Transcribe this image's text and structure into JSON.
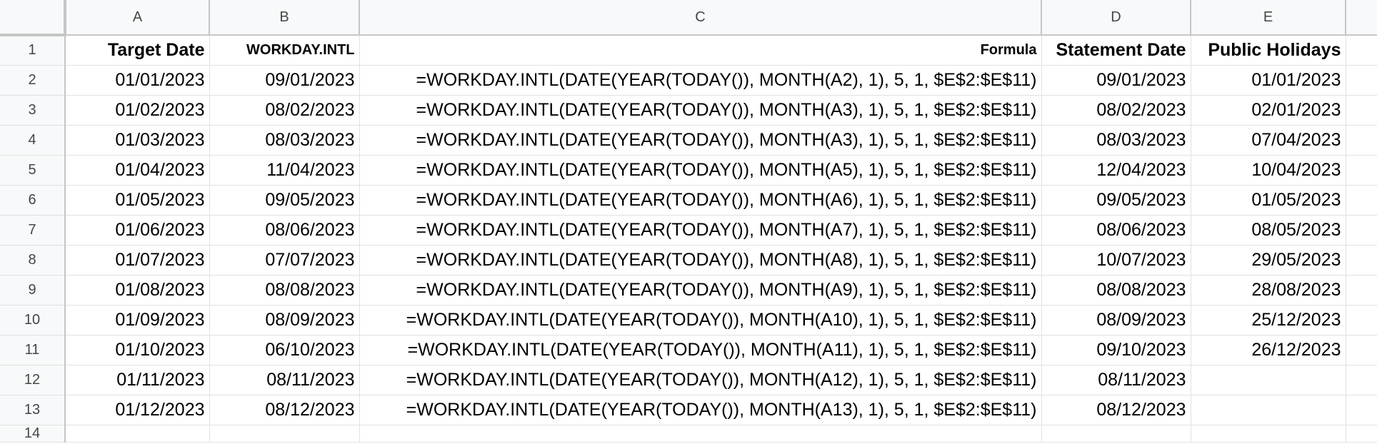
{
  "columns": [
    "A",
    "B",
    "C",
    "D",
    "E"
  ],
  "header_row": {
    "num": "1",
    "a": "Target Date",
    "b": "WORKDAY.INTL",
    "c": "Formula",
    "d": "Statement Date",
    "e": "Public Holidays"
  },
  "rows": [
    {
      "num": "2",
      "a": "01/01/2023",
      "b": "09/01/2023",
      "c": "=WORKDAY.INTL(DATE(YEAR(TODAY()), MONTH(A2), 1), 5, 1, $E$2:$E$11)",
      "d": "09/01/2023",
      "e": "01/01/2023"
    },
    {
      "num": "3",
      "a": "01/02/2023",
      "b": "08/02/2023",
      "c": "=WORKDAY.INTL(DATE(YEAR(TODAY()), MONTH(A3), 1), 5, 1, $E$2:$E$11)",
      "d": "08/02/2023",
      "e": "02/01/2023"
    },
    {
      "num": "4",
      "a": "01/03/2023",
      "b": "08/03/2023",
      "c": "=WORKDAY.INTL(DATE(YEAR(TODAY()), MONTH(A3), 1), 5, 1, $E$2:$E$11)",
      "d": "08/03/2023",
      "e": "07/04/2023"
    },
    {
      "num": "5",
      "a": "01/04/2023",
      "b": "11/04/2023",
      "c": "=WORKDAY.INTL(DATE(YEAR(TODAY()), MONTH(A5), 1), 5, 1, $E$2:$E$11)",
      "d": "12/04/2023",
      "e": "10/04/2023"
    },
    {
      "num": "6",
      "a": "01/05/2023",
      "b": "09/05/2023",
      "c": "=WORKDAY.INTL(DATE(YEAR(TODAY()), MONTH(A6), 1), 5, 1, $E$2:$E$11)",
      "d": "09/05/2023",
      "e": "01/05/2023"
    },
    {
      "num": "7",
      "a": "01/06/2023",
      "b": "08/06/2023",
      "c": "=WORKDAY.INTL(DATE(YEAR(TODAY()), MONTH(A7), 1), 5, 1, $E$2:$E$11)",
      "d": "08/06/2023",
      "e": "08/05/2023"
    },
    {
      "num": "8",
      "a": "01/07/2023",
      "b": "07/07/2023",
      "c": "=WORKDAY.INTL(DATE(YEAR(TODAY()), MONTH(A8), 1), 5, 1, $E$2:$E$11)",
      "d": "10/07/2023",
      "e": "29/05/2023"
    },
    {
      "num": "9",
      "a": "01/08/2023",
      "b": "08/08/2023",
      "c": "=WORKDAY.INTL(DATE(YEAR(TODAY()), MONTH(A9), 1), 5, 1, $E$2:$E$11)",
      "d": "08/08/2023",
      "e": "28/08/2023"
    },
    {
      "num": "10",
      "a": "01/09/2023",
      "b": "08/09/2023",
      "c": "=WORKDAY.INTL(DATE(YEAR(TODAY()), MONTH(A10), 1), 5, 1, $E$2:$E$11)",
      "d": "08/09/2023",
      "e": "25/12/2023"
    },
    {
      "num": "11",
      "a": "01/10/2023",
      "b": "06/10/2023",
      "c": "=WORKDAY.INTL(DATE(YEAR(TODAY()), MONTH(A11), 1), 5, 1, $E$2:$E$11)",
      "d": "09/10/2023",
      "e": "26/12/2023"
    },
    {
      "num": "12",
      "a": "01/11/2023",
      "b": "08/11/2023",
      "c": "=WORKDAY.INTL(DATE(YEAR(TODAY()), MONTH(A12), 1), 5, 1, $E$2:$E$11)",
      "d": "08/11/2023",
      "e": ""
    },
    {
      "num": "13",
      "a": "01/12/2023",
      "b": "08/12/2023",
      "c": "=WORKDAY.INTL(DATE(YEAR(TODAY()), MONTH(A13), 1), 5, 1, $E$2:$E$11)",
      "d": "08/12/2023",
      "e": ""
    }
  ],
  "trailing_row": {
    "num": "14"
  }
}
